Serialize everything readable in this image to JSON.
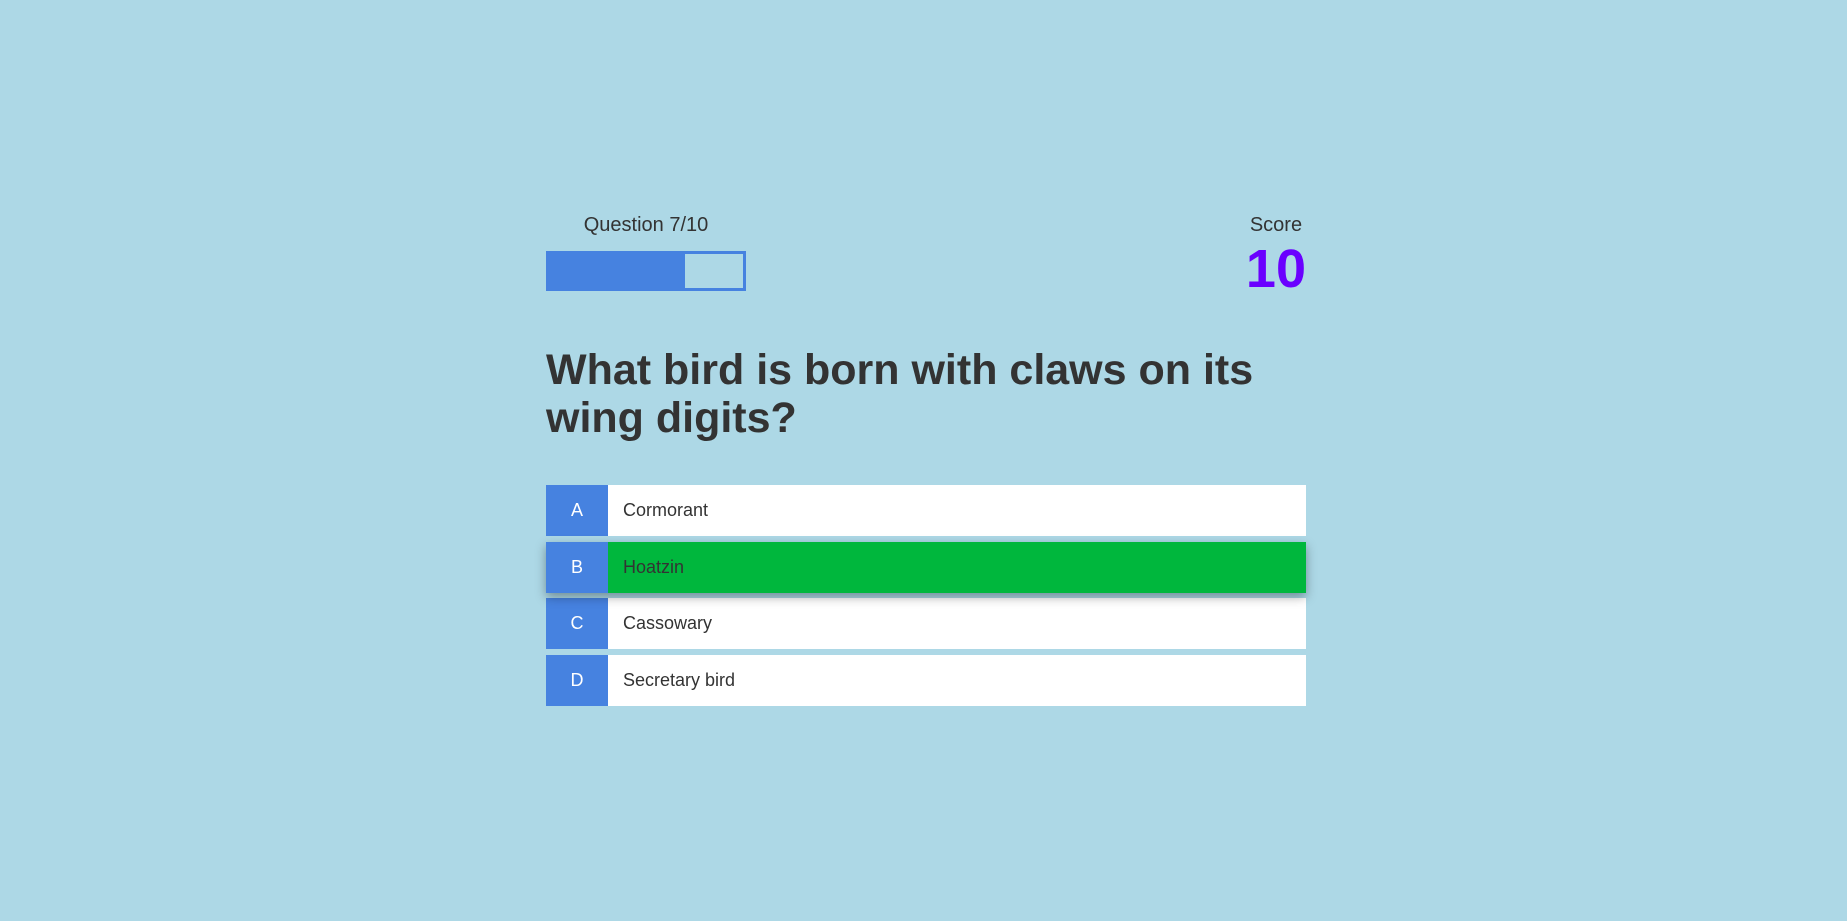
{
  "progress": {
    "label": "Question 7/10",
    "current": 7,
    "total": 10,
    "fill_fraction": 0.7
  },
  "score": {
    "label": "Score",
    "value": "10"
  },
  "question": {
    "text": "What bird is born with claws on its wing digits?"
  },
  "choices": [
    {
      "letter": "A",
      "text": "Cormorant",
      "selected": false
    },
    {
      "letter": "B",
      "text": "Hoatzin",
      "selected": true
    },
    {
      "letter": "C",
      "text": "Cassowary",
      "selected": false
    },
    {
      "letter": "D",
      "text": "Secretary bird",
      "selected": false
    }
  ],
  "colors": {
    "background": "#add8e6",
    "accent": "#4682e0",
    "score": "#6a00ff",
    "selected": "#00b73d"
  }
}
